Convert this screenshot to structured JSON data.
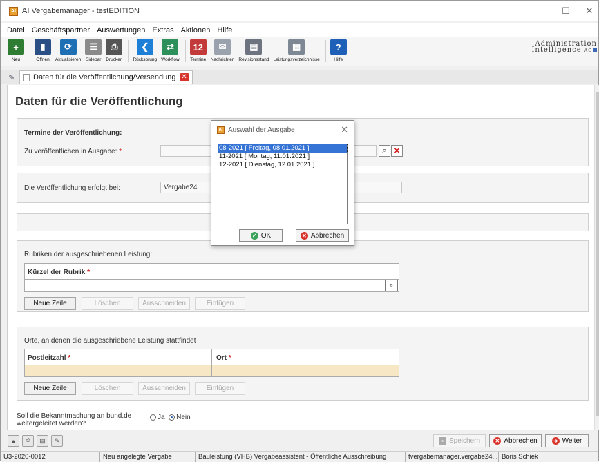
{
  "window": {
    "title": "AI Vergabemanager - testEDITION",
    "app_icon": "AI"
  },
  "menu": [
    "Datei",
    "Geschäftspartner",
    "Auswertungen",
    "Extras",
    "Aktionen",
    "Hilfe"
  ],
  "toolbar": {
    "items": [
      {
        "label": "Neu",
        "icon": "new-icon",
        "color": "#2e7d32",
        "glyph": "+"
      },
      {
        "label": "Öffnen",
        "icon": "open-icon",
        "color": "#2a4f85",
        "glyph": "▮"
      },
      {
        "label": "Aktualisieren",
        "icon": "refresh-icon",
        "color": "#1f6fb5",
        "glyph": "⟳"
      },
      {
        "label": "Sidebar",
        "icon": "sidebar-icon",
        "color": "#8a8a8a",
        "glyph": "☰"
      },
      {
        "label": "Drucken",
        "icon": "print-icon",
        "color": "#555555",
        "glyph": "⎙"
      },
      {
        "label": "Rücksprung",
        "icon": "back-icon",
        "color": "#1e7fd6",
        "glyph": "❮"
      },
      {
        "label": "Workflow",
        "icon": "workflow-icon",
        "color": "#2d8f5a",
        "glyph": "⇄"
      },
      {
        "label": "Termine",
        "icon": "calendar-icon",
        "color": "#c23a3a",
        "glyph": "12"
      },
      {
        "label": "Nachrichten",
        "icon": "mail-icon",
        "color": "#9aa3ad",
        "glyph": "✉"
      },
      {
        "label": "Revisionsstand",
        "icon": "revision-icon",
        "color": "#6d7480",
        "glyph": "▤"
      },
      {
        "label": "Leistungsverzeichnisse",
        "icon": "grid-icon",
        "color": "#7e8794",
        "glyph": "▦"
      },
      {
        "label": "Hilfe",
        "icon": "help-icon",
        "color": "#1e5fb8",
        "glyph": "?"
      }
    ]
  },
  "brand": {
    "line1": "Administration",
    "line2": "Intelligence",
    "suffix": "AG"
  },
  "tabs": {
    "active": "Daten für die Veröffentlichung/Versendung"
  },
  "page": {
    "title": "Daten für die Veröffentlichung",
    "termine": {
      "heading": "Termine der Veröffentlichung:",
      "ausgabe_label": "Zu veröffentlichen in Ausgabe:",
      "ausgabe_value": ""
    },
    "erfolgt": {
      "label": "Die Veröffentlichung erfolgt bei:",
      "value": "Vergabe24"
    },
    "rubriken": {
      "heading": "Rubriken der ausgeschriebenen Leistung:",
      "col": "Kürzel der Rubrik"
    },
    "orte": {
      "heading": "Orte, an denen die ausgeschriebene Leistung stattfindet",
      "col1": "Postleitzahl",
      "col2": "Ort"
    },
    "row_buttons": {
      "new": "Neue Zeile",
      "delete": "Löschen",
      "cut": "Ausschneiden",
      "paste": "Einfügen"
    },
    "bund": {
      "question": "Soll die Bekanntmachung an bund.de weitergeleitet werden?",
      "ja": "Ja",
      "nein": "Nein",
      "selected": "Nein"
    }
  },
  "bottom": {
    "save": "Speichern",
    "cancel": "Abbrechen",
    "next": "Weiter"
  },
  "status": [
    "U3-2020-0012",
    "Neu angelegte Vergabe",
    "Bauleistung (VHB) Vergabeassistent - Öffentliche Ausschreibung",
    "tvergabemanager.vergabe24....",
    "Boris Schiek"
  ],
  "dialog": {
    "title": "Auswahl der Ausgabe",
    "items": [
      "08-2021  [ Freitag, 08.01.2021 ]",
      "11-2021  [ Montag, 11.01.2021 ]",
      "12-2021  [ Dienstag, 12.01.2021 ]"
    ],
    "selected_index": 0,
    "ok": "OK",
    "cancel": "Abbrechen"
  },
  "colors": {
    "accent": "#3574d4",
    "required_row": "#f8e7c4",
    "cancel_red": "#d9342b",
    "ok_green": "#3aa35a"
  }
}
